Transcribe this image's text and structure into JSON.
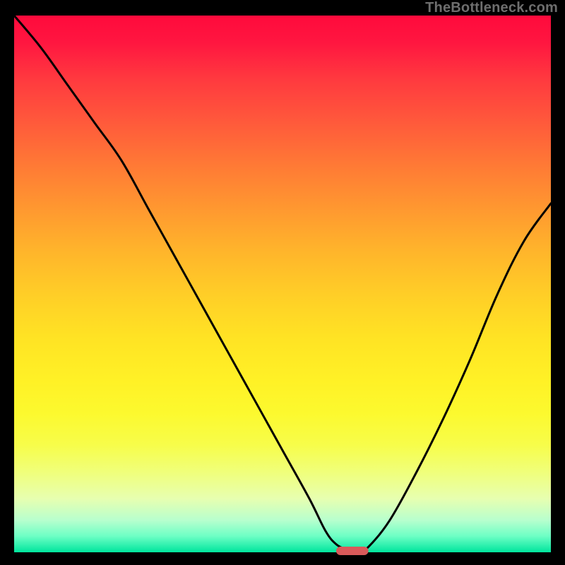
{
  "watermark": "TheBottleneck.com",
  "colors": {
    "frame": "#000000",
    "curve": "#000000",
    "marker": "#d95a5a",
    "gradient_top": "#ff0a3c",
    "gradient_bottom": "#00e59d"
  },
  "chart_data": {
    "type": "line",
    "title": "",
    "xlabel": "",
    "ylabel": "",
    "xlim": [
      0,
      100
    ],
    "ylim": [
      0,
      100
    ],
    "grid": false,
    "legend": false,
    "series": [
      {
        "name": "bottleneck-curve",
        "x": [
          0,
          5,
          10,
          15,
          20,
          25,
          30,
          35,
          40,
          45,
          50,
          55,
          58,
          60,
          62,
          64,
          66,
          70,
          75,
          80,
          85,
          90,
          95,
          100
        ],
        "values": [
          100,
          94,
          87,
          80,
          73,
          64,
          55,
          46,
          37,
          28,
          19,
          10,
          4,
          1.5,
          0.5,
          0,
          1,
          6,
          15,
          25,
          36,
          48,
          58,
          65
        ]
      }
    ],
    "marker": {
      "x_start": 60,
      "x_end": 66,
      "y": 0,
      "label": ""
    }
  }
}
